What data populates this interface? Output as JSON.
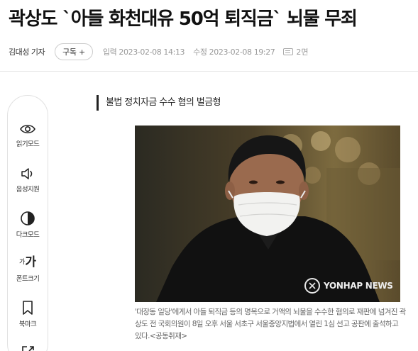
{
  "article": {
    "headline": "곽상도 `아들 화천대유 50억 퇴직금` 뇌물 무죄",
    "reporter": "김대성 기자",
    "subscribe_label": "구독 +",
    "published": "입력 2023-02-08 14:13",
    "updated": "수정 2023-02-08 19:27",
    "page": "2면",
    "subheading": "불법 정치자금 수수 혐의 벌금형",
    "photo_watermark": "YONHAP NEWS",
    "caption": "'대장동 일당'에게서 아들 퇴직금 등의 명목으로 거액의 뇌물을 수수한 혐의로 재판에 넘겨진 곽상도 전 국회의원이 8일 오후 서울 서초구 서울중앙지법에서 열린 1심 선고 공판에 출석하고 있다.<공동취재>"
  },
  "toolbar": {
    "items": [
      {
        "label": "읽기모드",
        "icon": "eye-icon"
      },
      {
        "label": "음성지원",
        "icon": "speaker-icon"
      },
      {
        "label": "다크모드",
        "icon": "contrast-icon"
      },
      {
        "label": "폰트크기",
        "icon": "font-size-icon",
        "glyph_small": "가",
        "glyph_large": "가"
      },
      {
        "label": "북마크",
        "icon": "bookmark-icon"
      }
    ]
  },
  "colors": {
    "text": "#222222",
    "muted": "#999999",
    "border": "#e1e1e1",
    "photo_background": "#3a3324"
  }
}
